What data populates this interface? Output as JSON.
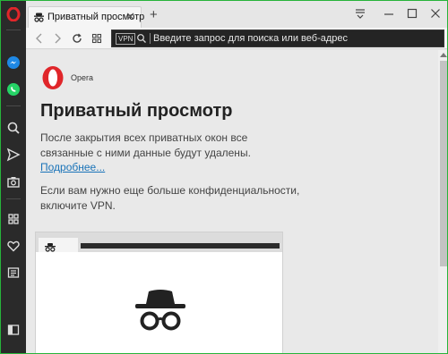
{
  "tabs": [
    {
      "title": "Приватный просмотр",
      "close": "✕"
    }
  ],
  "new_tab_label": "+",
  "window_controls": {
    "menu": "menu-icon",
    "minimize": "—",
    "maximize": "□",
    "close": "✕"
  },
  "toolbar": {
    "vpn_label": "VPN",
    "address_placeholder": "Введите запрос для поиска или веб-адрес"
  },
  "page": {
    "logo_text": "Opera",
    "heading": "Приватный просмотр",
    "paragraph1": "После закрытия всех приватных окон все связанные с ними данные будут удалены.",
    "learn_more": "Подробнее...",
    "paragraph2": "Если вам нужно еще больше конфиденциальности, включите VPN."
  },
  "colors": {
    "accent_green": "#27b43a",
    "opera_red": "#e0262a",
    "link": "#1a73b8"
  },
  "sidebar_icons": [
    "opera-logo-icon",
    "messenger-icon",
    "whatsapp-icon",
    "search-icon",
    "send-icon",
    "camera-icon",
    "speed-dial-icon",
    "heart-icon",
    "news-icon",
    "sidebar-toggle-icon"
  ]
}
